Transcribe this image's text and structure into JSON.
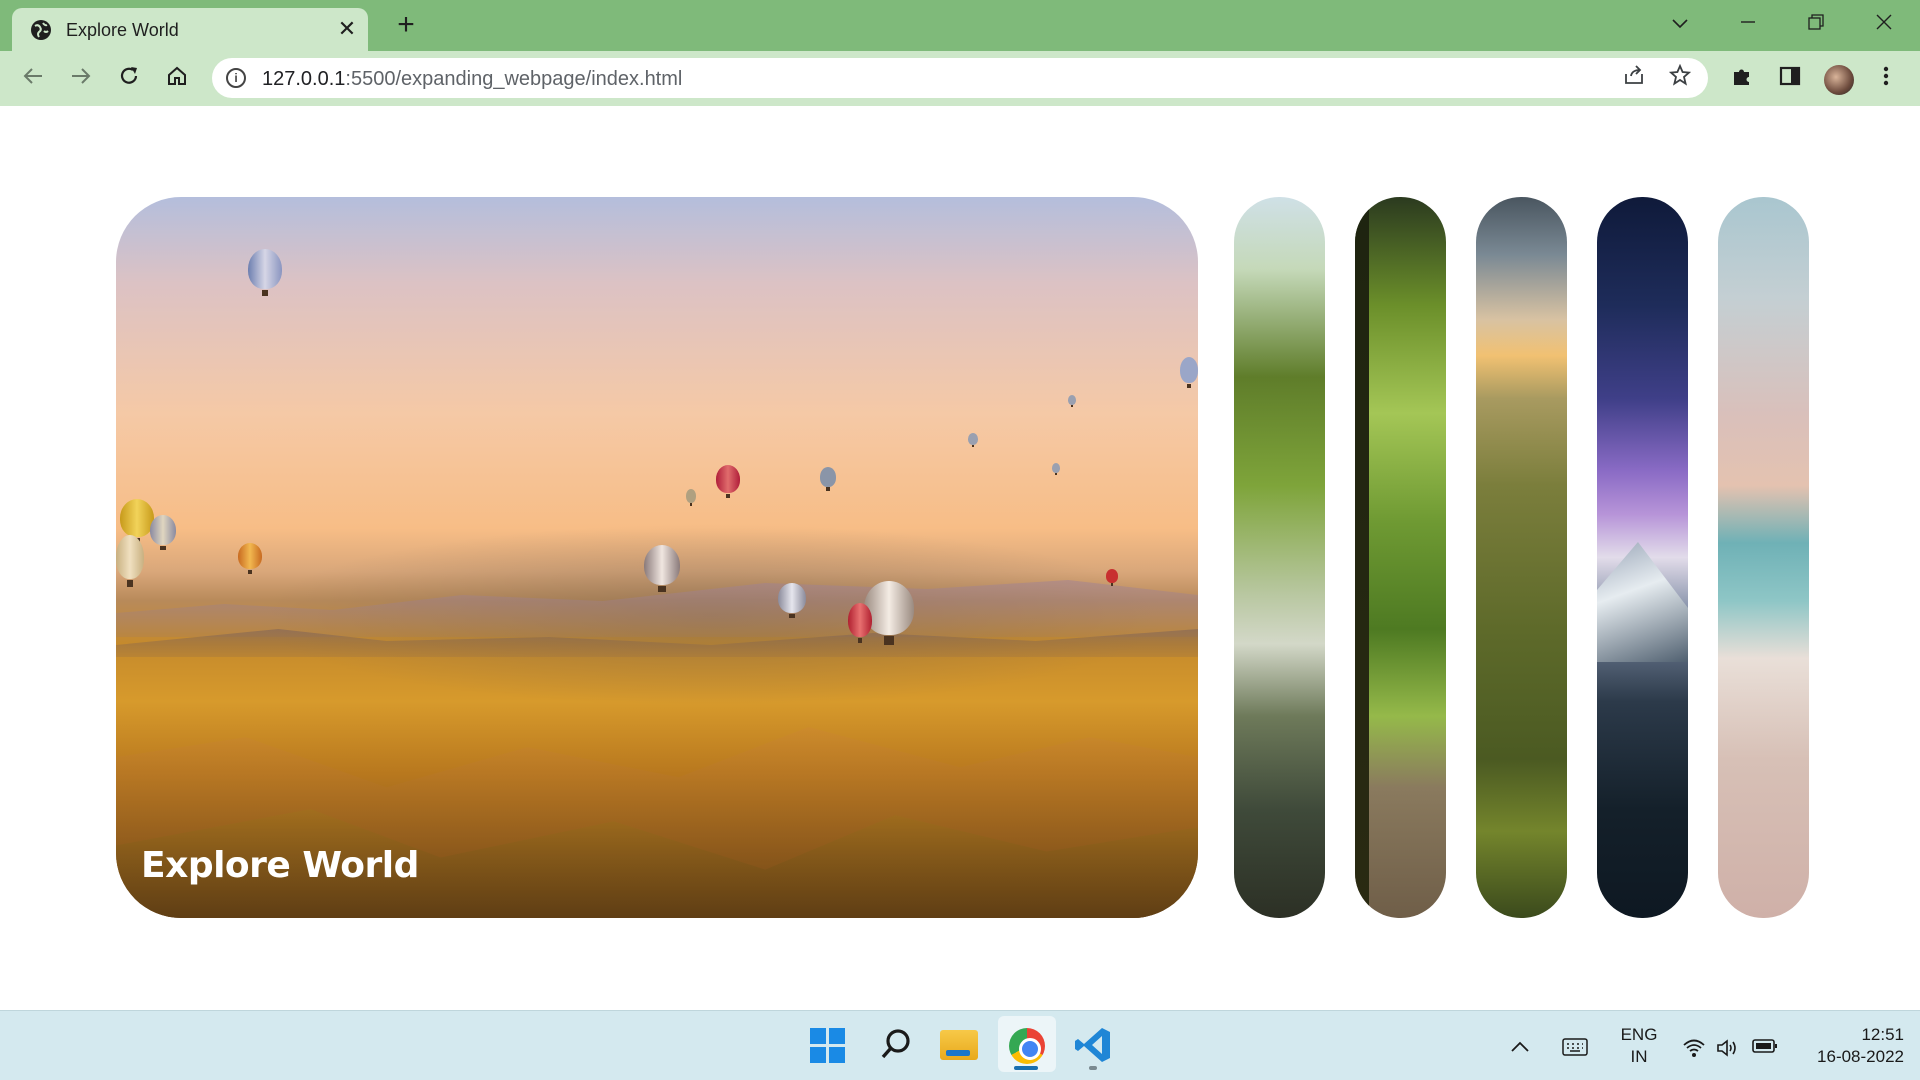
{
  "browser": {
    "tab_title": "Explore World",
    "tab_close": "✕",
    "new_tab": "+",
    "url_host": "127.0.0.1",
    "url_path": ":5500/expanding_webpage/index.html",
    "icons": {
      "favicon": "globe-icon",
      "back": "arrow-left-icon",
      "forward": "arrow-right-icon",
      "reload": "reload-icon",
      "home": "home-icon",
      "info": "info-icon",
      "share": "share-icon",
      "bookmark": "star-icon",
      "extensions": "puzzle-icon",
      "sidepanel": "sidepanel-icon",
      "menu": "kebab-menu-icon",
      "tab_search": "chevron-down-icon",
      "minimize": "minimize-icon",
      "restore": "restore-icon",
      "close": "close-icon"
    },
    "accent_color": "#7fba7a"
  },
  "gallery": {
    "active_panel_title": "Explore World",
    "panels": [
      {
        "name": "balloons"
      },
      {
        "name": "forest-river"
      },
      {
        "name": "forest-path"
      },
      {
        "name": "mountain-sunset"
      },
      {
        "name": "starry-mountain"
      },
      {
        "name": "beach"
      }
    ]
  },
  "taskbar": {
    "icons": [
      "windows-start-icon",
      "search-icon",
      "file-explorer-icon",
      "chrome-icon",
      "vscode-icon"
    ],
    "language_line1": "ENG",
    "language_line2": "IN",
    "time": "12:51",
    "date": "16-08-2022"
  }
}
